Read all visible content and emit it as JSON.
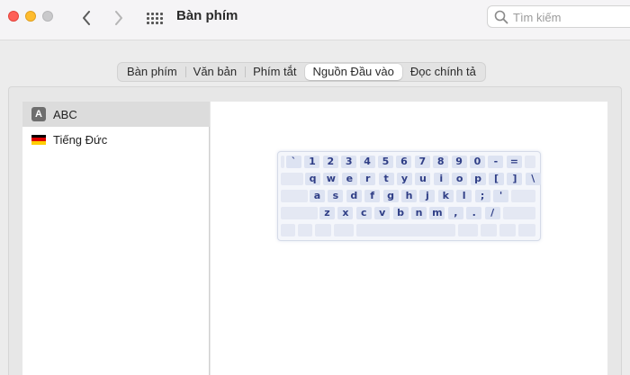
{
  "window": {
    "title": "Bàn phím"
  },
  "search": {
    "placeholder": "Tìm kiếm",
    "value": ""
  },
  "tabs": [
    {
      "label": "Bàn phím",
      "active": false
    },
    {
      "label": "Văn bản",
      "active": false
    },
    {
      "label": "Phím tắt",
      "active": false
    },
    {
      "label": "Nguồn Đầu vào",
      "active": true
    },
    {
      "label": "Đọc chính tả",
      "active": false
    }
  ],
  "input_sources": [
    {
      "label": "ABC",
      "icon": "abc-letter-icon",
      "icon_text": "A",
      "selected": true
    },
    {
      "label": "Tiếng Đức",
      "icon": "german-flag-icon",
      "selected": false
    }
  ],
  "keyboard_preview": {
    "rows": [
      [
        "`",
        "1",
        "2",
        "3",
        "4",
        "5",
        "6",
        "7",
        "8",
        "9",
        "0",
        "-",
        "="
      ],
      [
        "q",
        "w",
        "e",
        "r",
        "t",
        "y",
        "u",
        "i",
        "o",
        "p",
        "[",
        "]",
        "\\"
      ],
      [
        "a",
        "s",
        "d",
        "f",
        "g",
        "h",
        "j",
        "k",
        "l",
        ";",
        "'"
      ],
      [
        "z",
        "x",
        "c",
        "v",
        "b",
        "n",
        "m",
        ",",
        ".",
        "/"
      ]
    ]
  },
  "colors": {
    "close": "#fe5f57",
    "minimize": "#febc2e",
    "selected_row": "#dcdcdc",
    "key_text": "#2f3e86",
    "key_fill": "#dde3f2"
  }
}
